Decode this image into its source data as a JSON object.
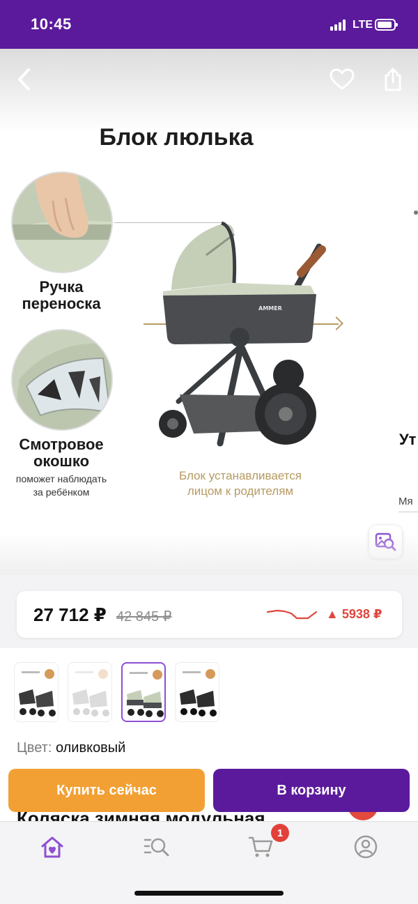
{
  "status_bar": {
    "time": "10:45",
    "network": "LTE",
    "icons": [
      "signal-icon",
      "battery-icon"
    ]
  },
  "header": {
    "icons": [
      "back-icon",
      "heart-icon",
      "share-icon"
    ]
  },
  "gallery": {
    "title": "Блок люлька",
    "feature_1": "Ручка\nпереноска",
    "feature_2": "Смотровое\nокошко",
    "feature_2_sub": "поможет наблюдать\nза ребёнком",
    "brand_mark": "AMMER",
    "caption": "Блок устанавливается\nлицом к родителям",
    "next_slide_title": "Ут",
    "next_slide_sub": "Мя",
    "visual_search_icon": "image-search-icon"
  },
  "price": {
    "current": "27 712 ₽",
    "old": "42 845 ₽",
    "delta": "▲ 5938 ₽",
    "delta_color": "#e0463c",
    "trend_icon": "price-history-graph"
  },
  "thumbnails": {
    "count": 4,
    "selected_index": 3
  },
  "product": {
    "color_label": "Цвет:",
    "color_value": "оливковый",
    "title_partial": "Коляска зимняя модульная"
  },
  "actions": {
    "buy_now": "Купить сейчас",
    "add_to_cart": "В корзину",
    "buy_color": "#f2a033",
    "cart_color": "#5b1a9b"
  },
  "tab_bar": {
    "tabs": [
      "home-icon",
      "catalog-search-icon",
      "cart-icon",
      "profile-icon"
    ],
    "cart_badge": "1",
    "active_color": "#8e4fd2"
  }
}
